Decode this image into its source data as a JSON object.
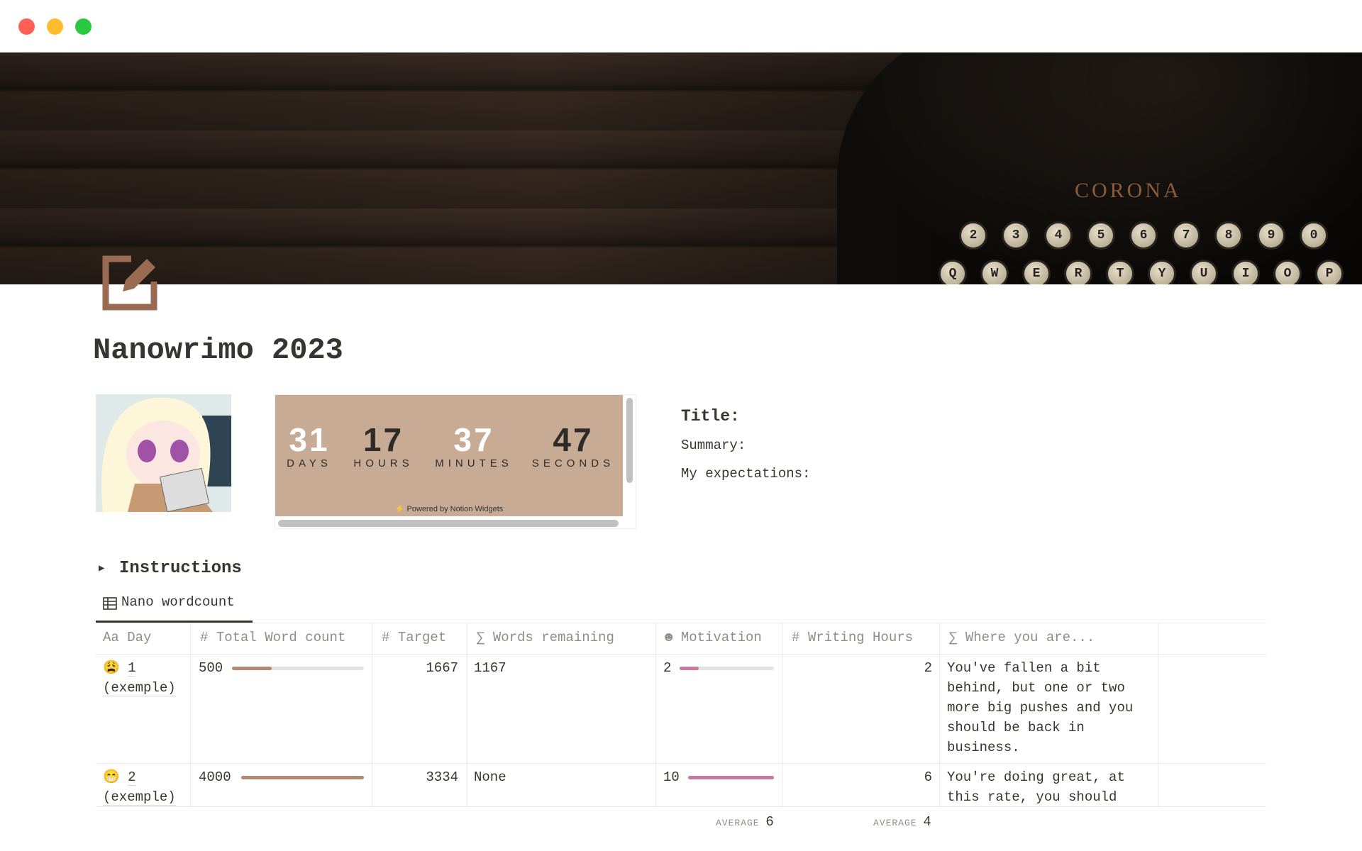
{
  "window": {
    "controls": [
      "close",
      "minimize",
      "maximize"
    ],
    "colors": {
      "close": "#ff5f57",
      "minimize": "#febc2e",
      "maximize": "#28c840"
    }
  },
  "cover": {
    "brand": "CORONA",
    "keys_top": [
      "2",
      "3",
      "4",
      "5",
      "6",
      "7",
      "8",
      "9",
      "0"
    ],
    "keys_bottom": [
      "Q",
      "W",
      "E",
      "R",
      "T",
      "Y",
      "U",
      "I",
      "O",
      "P"
    ]
  },
  "page": {
    "icon": "edit-square-icon",
    "title": "Nanowrimo 2023"
  },
  "countdown": {
    "days": "31",
    "days_label": "DAYS",
    "hours": "17",
    "hours_label": "HOURS",
    "minutes": "37",
    "minutes_label": "MINUTES",
    "seconds": "47",
    "seconds_label": "SECONDS",
    "powered": "Powered by Notion Widgets",
    "bg": "#c7ab95"
  },
  "info": {
    "title": "Title:",
    "summary": "Summary:",
    "expectations": "My expectations:"
  },
  "instructions": {
    "label": "Instructions"
  },
  "view": {
    "tab": "Nano wordcount"
  },
  "table": {
    "headers": [
      {
        "icon": "Aa",
        "label": "Day"
      },
      {
        "icon": "#",
        "label": "Total Word count"
      },
      {
        "icon": "#",
        "label": "Target"
      },
      {
        "icon": "∑",
        "label": "Words remaining"
      },
      {
        "icon": "☻",
        "label": "Motivation"
      },
      {
        "icon": "#",
        "label": "Writing Hours"
      },
      {
        "icon": "∑",
        "label": "Where you are..."
      }
    ],
    "rows": [
      {
        "emoji": "😩",
        "day": "1",
        "day2": "(exemple)",
        "words": "500",
        "words_pct": 30,
        "target": "1667",
        "remaining": "1167",
        "motivation": "2",
        "motivation_pct": 20,
        "hours": "2",
        "where": [
          "You've fallen a bit",
          "behind, but one or two",
          "more big pushes and you",
          "should be back in",
          "business."
        ]
      },
      {
        "emoji": "😁",
        "day": "2",
        "day2": "(exemple)",
        "words": "4000",
        "words_pct": 100,
        "target": "3334",
        "remaining": "None",
        "motivation": "10",
        "motivation_pct": 100,
        "hours": "6",
        "where": [
          "You're doing great, at",
          "this rate, you should"
        ]
      }
    ],
    "colors": {
      "words_bar": "#b08a72",
      "motivation_bar": "#c57a9e"
    }
  },
  "footer": {
    "avg_label": "AVERAGE",
    "motivation_avg": "6",
    "hours_avg": "4"
  }
}
